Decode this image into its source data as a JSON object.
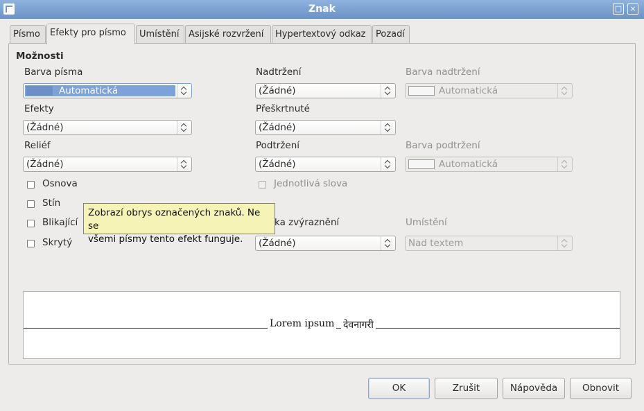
{
  "window": {
    "title": "Znak"
  },
  "tabs": [
    {
      "label": "Písmo",
      "active": false
    },
    {
      "label": "Efekty pro písmo",
      "active": true
    },
    {
      "label": "Umístění",
      "active": false
    },
    {
      "label": "Asijské rozvržení",
      "active": false
    },
    {
      "label": "Hypertextový odkaz",
      "active": false
    },
    {
      "label": "Pozadí",
      "active": false
    }
  ],
  "options": {
    "section_title": "Možnosti",
    "font_color": {
      "label": "Barva písma",
      "value": "Automatická"
    },
    "effects": {
      "label": "Efekty",
      "value": "(Žádné)"
    },
    "relief": {
      "label": "Reliéf",
      "value": "(Žádné)"
    },
    "overline": {
      "label": "Nadtržení",
      "value": "(Žádné)"
    },
    "overline_color": {
      "label": "Barva nadtržení",
      "value": "Automatická"
    },
    "strikethrough": {
      "label": "Přeškrtnuté",
      "value": "(Žádné)"
    },
    "underline": {
      "label": "Podtržení",
      "value": "(Žádné)"
    },
    "underline_color": {
      "label": "Barva podtržení",
      "value": "Automatická"
    },
    "outline": {
      "label": "Osnova",
      "checked": false
    },
    "shadow": {
      "label": "Stín",
      "checked": false
    },
    "blinking": {
      "label": "Blikající",
      "checked": false
    },
    "hidden": {
      "label": "Skrytý",
      "checked": false
    },
    "individual_words": {
      "label": "Jednotlivá slova",
      "checked": false,
      "disabled": true
    },
    "emphasis": {
      "label_partial": "ka zvýraznění",
      "value": "(Žádné)"
    },
    "position": {
      "label": "Umístění",
      "value": "Nad textem"
    }
  },
  "tooltip": {
    "line1": "Zobrazí obrys označených znaků. Ne se",
    "line2": "všemi písmy tento efekt funguje."
  },
  "preview": {
    "text_latin": "Lorem ipsum",
    "text_devanagari": "देवनागरी"
  },
  "buttons": {
    "ok": "OK",
    "cancel": "Zrušit",
    "help": "Nápověda",
    "reset": "Obnovit"
  },
  "colors": {
    "titlebar": "#7ba0d2",
    "selection": "#7ca2d8",
    "tooltip_bg": "#f5f3b6"
  }
}
